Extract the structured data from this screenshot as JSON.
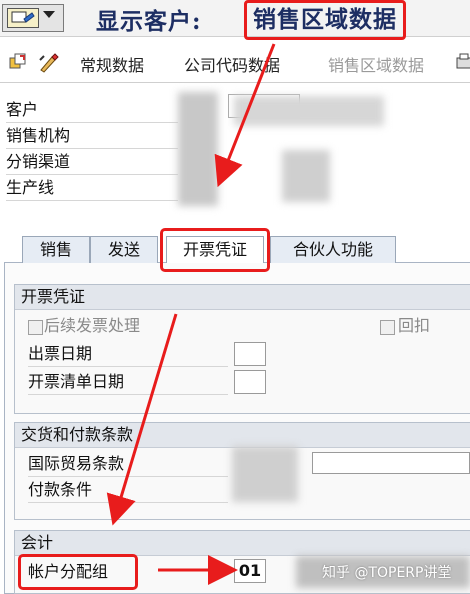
{
  "title": {
    "prefix": "显示客户:",
    "highlight": "销售区域数据"
  },
  "toolbar": {
    "items": [
      {
        "label": "常规数据",
        "enabled": true
      },
      {
        "label": "公司代码数据",
        "enabled": true
      },
      {
        "label": "销售区域数据",
        "enabled": false
      }
    ]
  },
  "header_fields": [
    {
      "label": "客户"
    },
    {
      "label": "销售机构"
    },
    {
      "label": "分销渠道"
    },
    {
      "label": "生产线"
    }
  ],
  "tabs": [
    {
      "label": "销售",
      "active": false
    },
    {
      "label": "发送",
      "active": false
    },
    {
      "label": "开票凭证",
      "active": true
    },
    {
      "label": "合伙人功能",
      "active": false
    }
  ],
  "billing_group": {
    "title": "开票凭证",
    "subsequent_invoice_label": "后续发票处理",
    "rebate_label": "回扣",
    "invoice_date_label": "出票日期",
    "invoice_list_date_label": "开票清单日期"
  },
  "delivery_group": {
    "title": "交货和付款条款",
    "incoterms_label": "国际贸易条款",
    "payment_terms_label": "付款条件"
  },
  "accounting_group": {
    "title": "会计",
    "account_assignment_label": "帐户分配组",
    "account_assignment_value": "01"
  },
  "watermark": "知乎 @TOPERP讲堂",
  "colors": {
    "annotation_red": "#e81c1c",
    "title_blue": "#1d2e63"
  }
}
